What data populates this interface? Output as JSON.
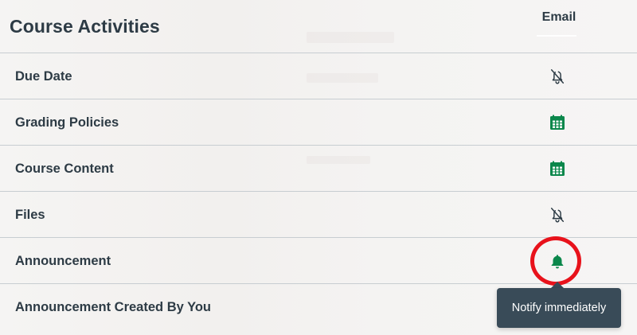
{
  "section": {
    "title": "Course Activities"
  },
  "columns": {
    "email_label": "Email"
  },
  "rows": [
    {
      "label": "Due Date",
      "icon": "bell-off-icon",
      "setting": "notifications off"
    },
    {
      "label": "Grading Policies",
      "icon": "calendar-icon",
      "setting": "weekly summary"
    },
    {
      "label": "Course Content",
      "icon": "calendar-icon",
      "setting": "weekly summary"
    },
    {
      "label": "Files",
      "icon": "bell-off-icon",
      "setting": "notifications off"
    },
    {
      "label": "Announcement",
      "icon": "bell-icon",
      "setting": "notify immediately",
      "highlighted": true
    },
    {
      "label": "Announcement Created By You",
      "icon": "none",
      "setting": ""
    }
  ],
  "tooltip": {
    "text": "Notify immediately"
  },
  "colors": {
    "text": "#2d3b45",
    "accent_green": "#0b874b",
    "muted_icon": "#2d3b45",
    "divider": "#c7cdd1",
    "highlight_ring": "#e8121b",
    "tooltip_bg": "#394b58"
  }
}
